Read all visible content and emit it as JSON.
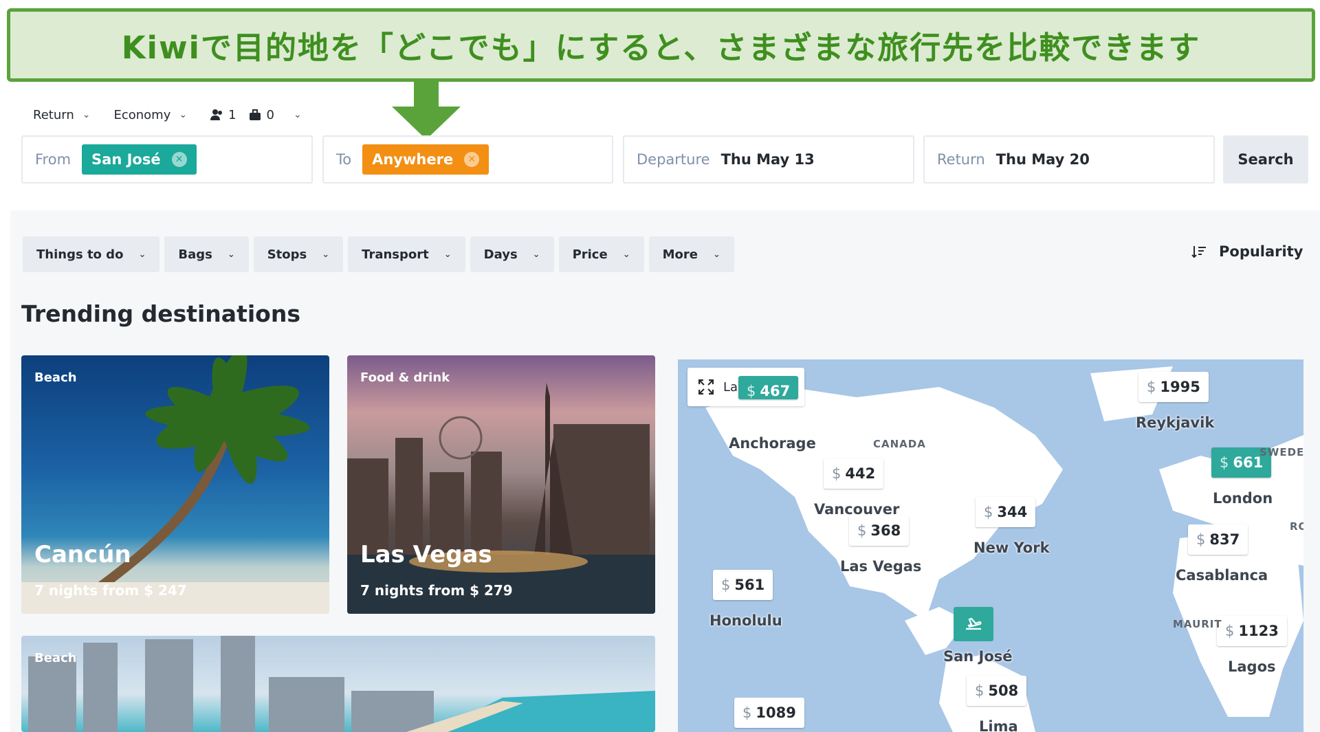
{
  "banner": {
    "text": "Kiwiで目的地を「どこでも」にすると、さまざまな旅行先を比較できます"
  },
  "top_options": {
    "trip_type": "Return",
    "cabin": "Economy",
    "passengers": "1",
    "bags": "0"
  },
  "search": {
    "from_label": "From",
    "from_value": "San José",
    "to_label": "To",
    "to_value": "Anywhere",
    "departure_label": "Departure",
    "departure_value": "Thu May 13",
    "return_label": "Return",
    "return_value": "Thu May 20",
    "search_button": "Search"
  },
  "filters": [
    "Things to do",
    "Bags",
    "Stops",
    "Transport",
    "Days",
    "Price",
    "More"
  ],
  "sort": {
    "label": "Popularity"
  },
  "trending": {
    "title": "Trending destinations",
    "cards": [
      {
        "category": "Beach",
        "city": "Cancún",
        "price": "7 nights from $ 247"
      },
      {
        "category": "Food & drink",
        "city": "Las Vegas",
        "price": "7 nights from $ 279"
      },
      {
        "category": "Beach"
      }
    ]
  },
  "map": {
    "large_map": "Large map",
    "currency": "$",
    "pins": [
      {
        "price": "1995",
        "city": "Reykjavik"
      },
      {
        "price": "661",
        "city": "London"
      },
      {
        "price": "442",
        "city": "Vancouver"
      },
      {
        "price": "344",
        "city": "New York"
      },
      {
        "price": "368",
        "city": "Las Vegas"
      },
      {
        "price": "837",
        "city": "Casablanca"
      },
      {
        "price": "561",
        "city": "Honolulu"
      },
      {
        "price": "1123",
        "city": "Lagos"
      },
      {
        "price": "508",
        "city": "Lima"
      },
      {
        "price": "1089",
        "city": ""
      },
      {
        "price": "467",
        "city": "Anchorage"
      }
    ],
    "home_city": "San José",
    "region_labels": [
      "CANADA",
      "SWEDEN",
      "MAURIT",
      "RO"
    ]
  },
  "colors": {
    "banner_green": "#5aa33b",
    "chip_teal": "#1aa99a",
    "chip_orange": "#f38f13",
    "map_water": "#a8c6e6"
  }
}
